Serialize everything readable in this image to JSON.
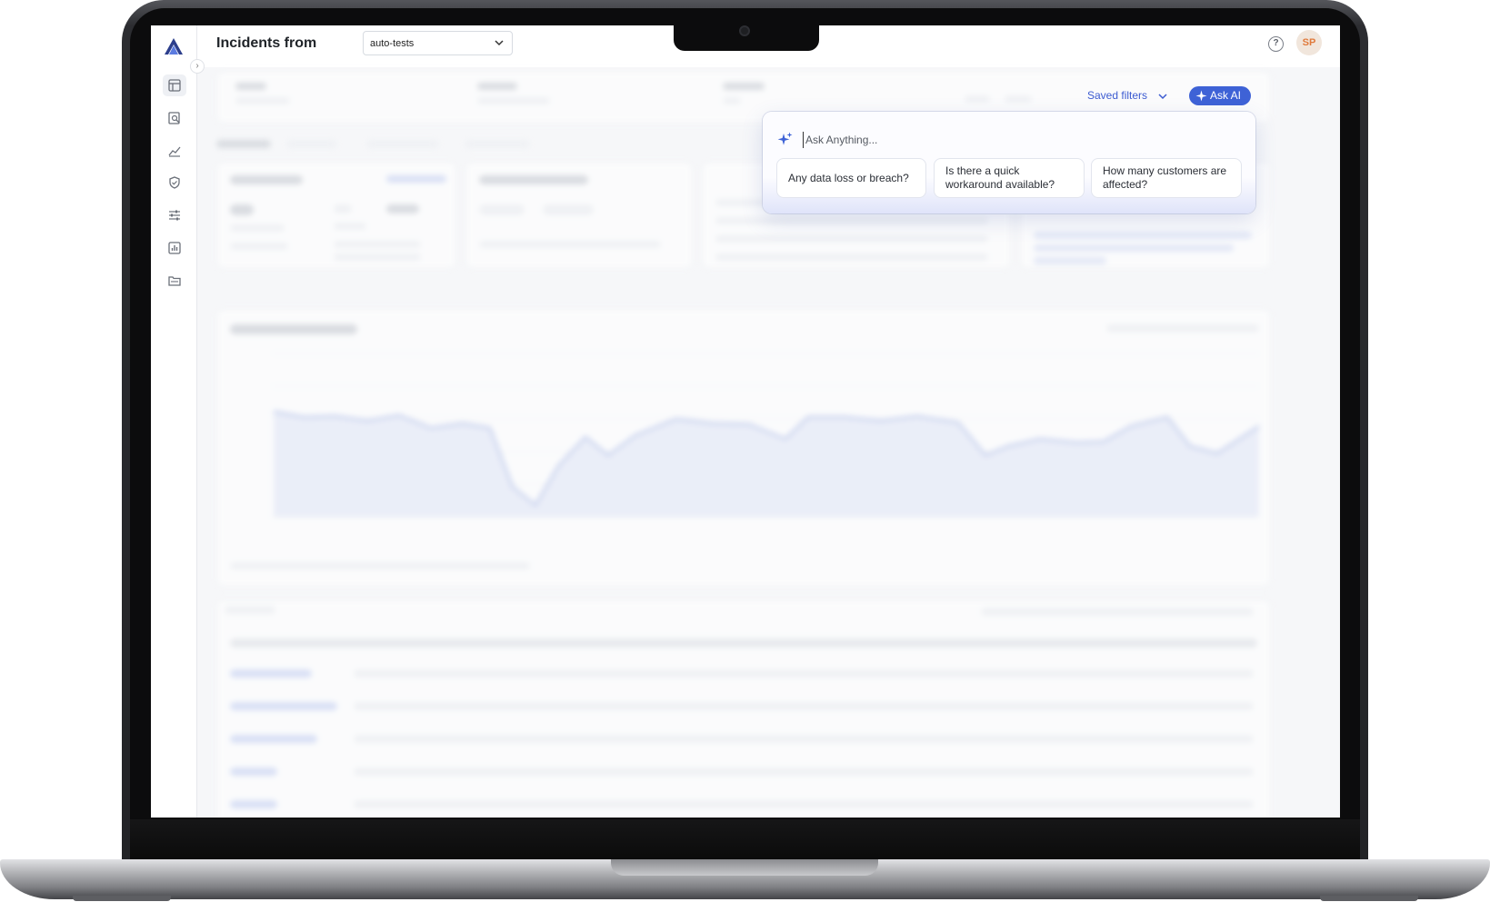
{
  "app": {
    "page_title": "Incidents from",
    "workspace_select": "auto-tests",
    "user_initials": "SP",
    "help_glyph": "?"
  },
  "sidebar": {
    "items": [
      {
        "icon": "dashboard-icon"
      },
      {
        "icon": "search-document-icon"
      },
      {
        "icon": "analytics-icon"
      },
      {
        "icon": "shield-check-icon"
      },
      {
        "icon": "sliders-icon"
      },
      {
        "icon": "report-icon"
      },
      {
        "icon": "folder-icon"
      }
    ]
  },
  "toolbar": {
    "saved_filters": "Saved filters",
    "ask_ai": "Ask AI"
  },
  "ai_panel": {
    "placeholder": "Ask Anything...",
    "suggestions": [
      "Any data loss or breach?",
      "Is there a quick workaround available?",
      "How many customers are affected?"
    ]
  },
  "colors": {
    "accent": "#3e62d6",
    "avatar_text": "#e07a3c",
    "chart_line": "#8fa3e0"
  }
}
